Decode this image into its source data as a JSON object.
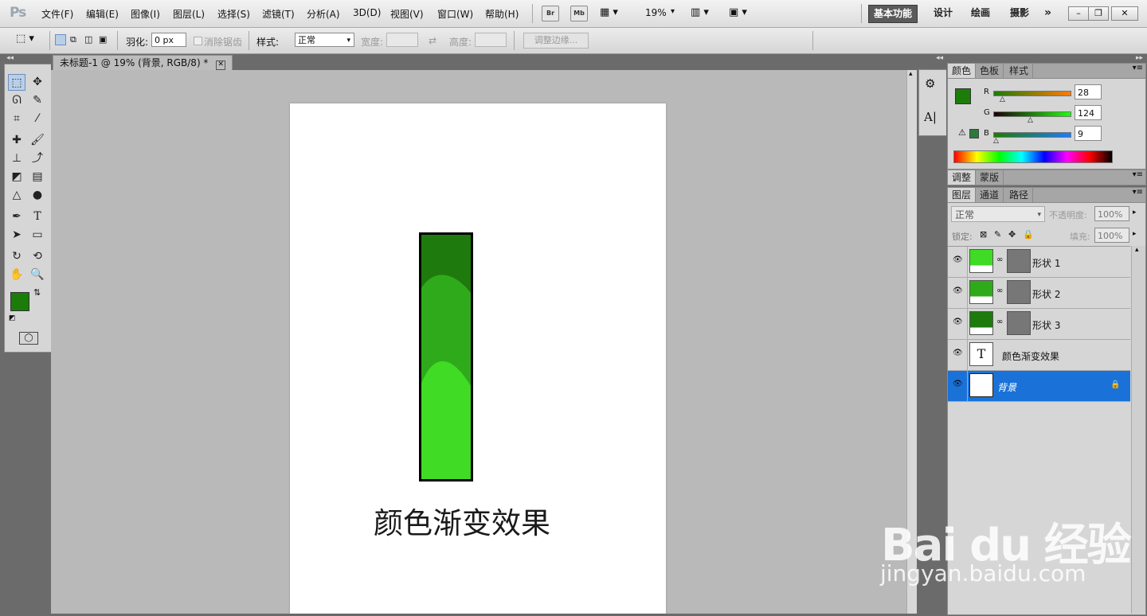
{
  "app": {
    "logo": "Ps"
  },
  "menu": [
    "文件(F)",
    "编辑(E)",
    "图像(I)",
    "图层(L)",
    "选择(S)",
    "滤镜(T)",
    "分析(A)",
    "3D(D)",
    "视图(V)",
    "窗口(W)",
    "帮助(H)"
  ],
  "appbar": {
    "bridge": "Br",
    "minibridge": "Mb",
    "zoom": "19%"
  },
  "workspaces": [
    "基本功能",
    "设计",
    "绘画",
    "摄影"
  ],
  "workspace_more": "»",
  "window_controls": {
    "minimize": "–",
    "restore": "❐",
    "close": "✕"
  },
  "options": {
    "feather_label": "羽化:",
    "feather_value": "0 px",
    "antialias_label": "消除锯齿",
    "style_label": "样式:",
    "style_value": "正常",
    "width_label": "宽度:",
    "height_label": "高度:",
    "refine_edge": "调整边缘..."
  },
  "document": {
    "tab_title": "未标题-1 @ 19% (背景, RGB/8) *",
    "caption": "颜色渐变效果"
  },
  "color_panel": {
    "tabs": [
      "颜色",
      "色板",
      "样式"
    ],
    "r_label": "R",
    "r_value": "28",
    "g_label": "G",
    "g_value": "124",
    "b_label": "B",
    "b_value": "9",
    "foreground": "#1c7c09",
    "background": "#ffffff"
  },
  "adjust_panel": {
    "tabs": [
      "调整",
      "蒙版"
    ]
  },
  "layers_panel": {
    "tabs": [
      "图层",
      "通道",
      "路径"
    ],
    "blend_mode": "正常",
    "opacity_label": "不透明度:",
    "opacity_value": "100%",
    "lock_label": "锁定:",
    "fill_label": "填充:",
    "fill_value": "100%",
    "layers": [
      {
        "name": "形状 1",
        "color": "#3fdb25"
      },
      {
        "name": "形状 2",
        "color": "#2faa1b"
      },
      {
        "name": "形状 3",
        "color": "#1e7a0c"
      },
      {
        "name": "颜色渐变效果",
        "glyph": "T"
      },
      {
        "name": "背景"
      }
    ]
  },
  "watermark": {
    "logo": "Bai du 经验",
    "url": "jingyan.baidu.com"
  }
}
